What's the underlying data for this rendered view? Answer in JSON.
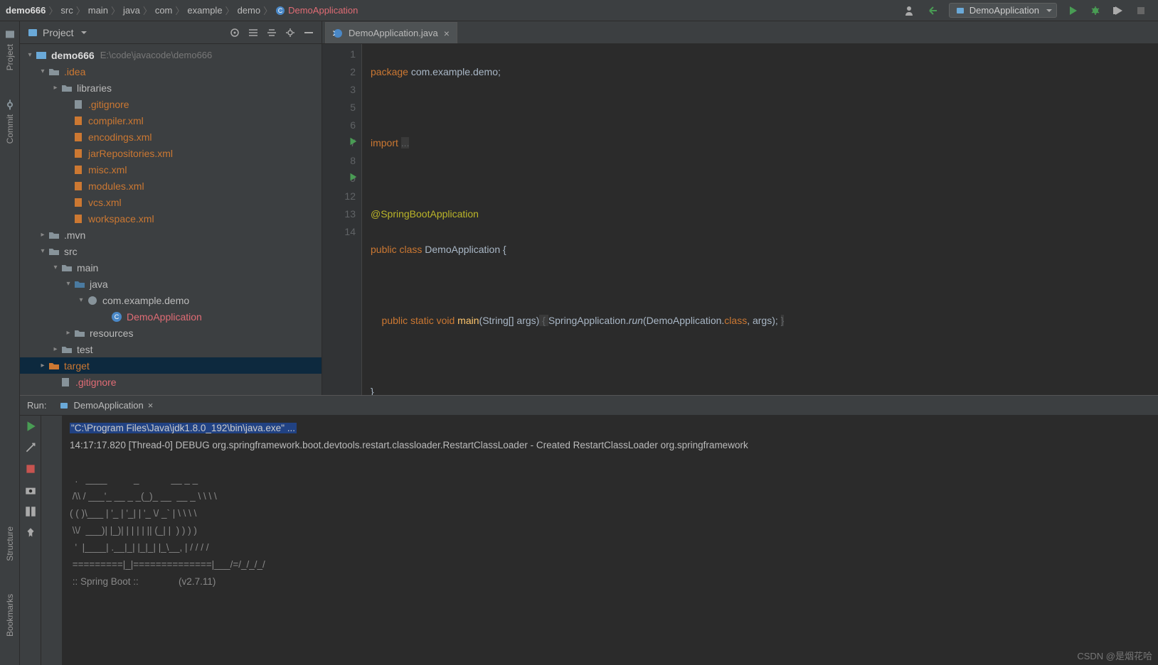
{
  "breadcrumb": {
    "root": "demo666",
    "items": [
      "src",
      "main",
      "java",
      "com",
      "example",
      "demo"
    ],
    "active": "DemoApplication"
  },
  "run_config": "DemoApplication",
  "project": {
    "title": "Project",
    "root_name": "demo666",
    "root_path": "E:\\code\\javacode\\demo666",
    "nodes": {
      "idea": ".idea",
      "libraries": "libraries",
      "gitignore1": ".gitignore",
      "compiler": "compiler.xml",
      "encodings": "encodings.xml",
      "jarrepo": "jarRepositories.xml",
      "misc": "misc.xml",
      "modules": "modules.xml",
      "vcs": "vcs.xml",
      "workspace": "workspace.xml",
      "mvn": ".mvn",
      "src": "src",
      "main": "main",
      "java": "java",
      "package": "com.example.demo",
      "democlass": "DemoApplication",
      "resources": "resources",
      "test": "test",
      "target": "target",
      "gitignore2": ".gitignore"
    }
  },
  "editor": {
    "tab_name": "DemoApplication.java",
    "lines": [
      "1",
      "2",
      "3",
      "5",
      "6",
      "7",
      "8",
      "9",
      "12",
      "13",
      "14"
    ],
    "code": {
      "l1a": "package ",
      "l1b": "com.example.demo;",
      "l3a": "import ",
      "l3b": "...",
      "l6": "@SpringBootApplication",
      "l7a": "public class ",
      "l7b": "DemoApplication {",
      "l9a": "    public static void ",
      "l9b": "main",
      "l9c": "(String[] args)",
      "l9d": " { ",
      "l9e": "SpringApplication.",
      "l9f": "run",
      "l9g": "(DemoApplication.",
      "l9h": "class",
      "l9i": ", args); ",
      "l9j": "}",
      "l13": "}"
    }
  },
  "run": {
    "title": "Run:",
    "tab": "DemoApplication",
    "console": {
      "l1": "\"C:\\Program Files\\Java\\jdk1.8.0_192\\bin\\java.exe\" ...",
      "l2": "14:17:17.820 [Thread-0] DEBUG org.springframework.boot.devtools.restart.classloader.RestartClassLoader - Created RestartClassLoader org.springframework",
      "banner": "  .   ____          _            __ _ _\n /\\\\ / ___'_ __ _ _(_)_ __  __ _ \\ \\ \\ \\\n( ( )\\___ | '_ | '_| | '_ \\/ _` | \\ \\ \\ \\\n \\\\/  ___)| |_)| | | | | || (_| |  ) ) ) )\n  '  |____| .__|_| |_|_| |_\\__, | / / / /\n =========|_|==============|___/=/_/_/_/\n :: Spring Boot ::               (v2.7.11)"
    }
  },
  "left_rail": {
    "project": "Project",
    "commit": "Commit",
    "structure": "Structure",
    "bookmarks": "Bookmarks"
  },
  "watermark": "CSDN @是烟花哈"
}
